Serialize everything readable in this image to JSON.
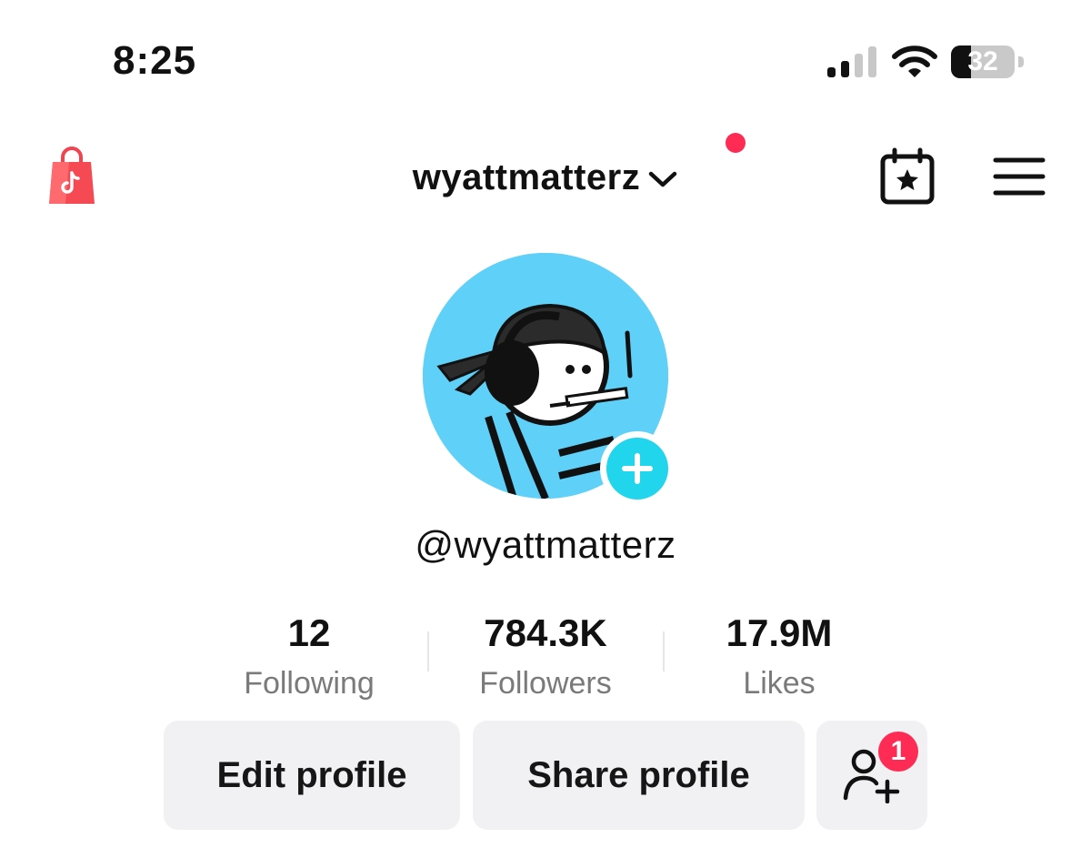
{
  "status_bar": {
    "time": "8:25",
    "battery_level": "32",
    "battery_fraction": 0.32
  },
  "header": {
    "username": "wyattmatterz",
    "icons": [
      "shopping-bag-icon",
      "chevron-down-icon",
      "calendar-star-icon",
      "menu-icon"
    ],
    "notification_dot_color": "#fe2c55"
  },
  "profile": {
    "handle": "@wyattmatterz",
    "avatar_bg_color": "#5fd0f7",
    "add_button_color": "#20d5ec"
  },
  "stats": [
    {
      "count": "12",
      "label": "Following"
    },
    {
      "count": "784.3K",
      "label": "Followers"
    },
    {
      "count": "17.9M",
      "label": "Likes"
    }
  ],
  "actions": {
    "edit_label": "Edit profile",
    "share_label": "Share profile",
    "add_friends_badge": "1"
  },
  "colors": {
    "accent": "#fe2c55",
    "button_bg": "#f1f1f3",
    "secondary_text": "#7a7a7a"
  }
}
